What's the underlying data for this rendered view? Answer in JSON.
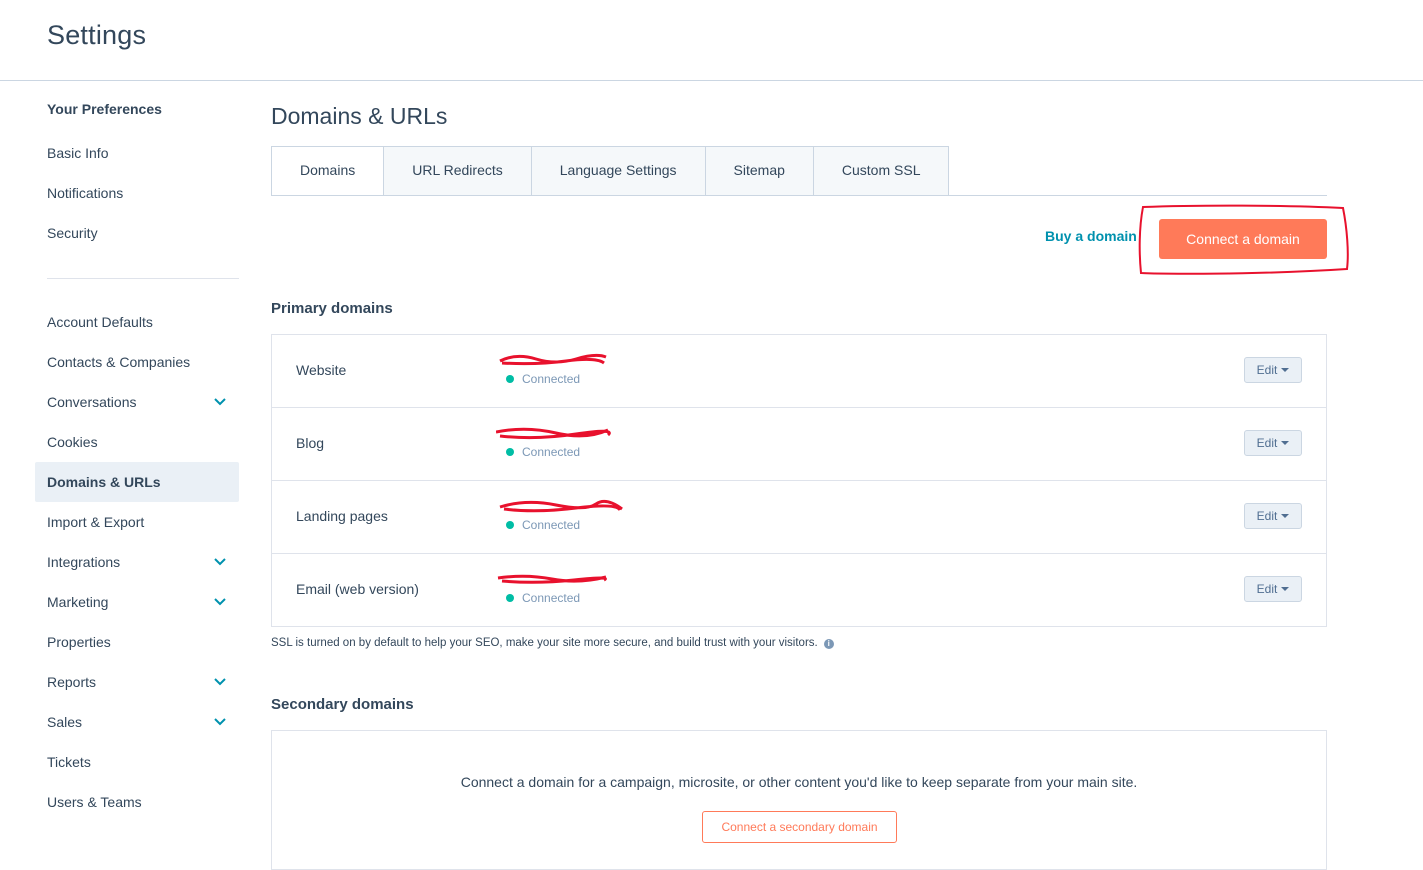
{
  "header": {
    "title": "Settings"
  },
  "sidebar": {
    "group_title": "Your Preferences",
    "pref_items": [
      {
        "label": "Basic Info"
      },
      {
        "label": "Notifications"
      },
      {
        "label": "Security"
      }
    ],
    "account_items": [
      {
        "label": "Account Defaults",
        "expandable": false
      },
      {
        "label": "Contacts & Companies",
        "expandable": false
      },
      {
        "label": "Conversations",
        "expandable": true
      },
      {
        "label": "Cookies",
        "expandable": false
      },
      {
        "label": "Domains & URLs",
        "expandable": false,
        "active": true
      },
      {
        "label": "Import & Export",
        "expandable": false
      },
      {
        "label": "Integrations",
        "expandable": true
      },
      {
        "label": "Marketing",
        "expandable": true
      },
      {
        "label": "Properties",
        "expandable": false
      },
      {
        "label": "Reports",
        "expandable": true
      },
      {
        "label": "Sales",
        "expandable": true
      },
      {
        "label": "Tickets",
        "expandable": false
      },
      {
        "label": "Users & Teams",
        "expandable": false
      }
    ]
  },
  "main": {
    "title": "Domains & URLs",
    "tabs": [
      {
        "label": "Domains",
        "active": true
      },
      {
        "label": "URL Redirects"
      },
      {
        "label": "Language Settings"
      },
      {
        "label": "Sitemap"
      },
      {
        "label": "Custom SSL"
      }
    ],
    "buy_domain_label": "Buy a domain",
    "connect_domain_label": "Connect a domain",
    "primary_title": "Primary domains",
    "primary_domains": [
      {
        "label": "Website",
        "status": "Connected",
        "edit_label": "Edit"
      },
      {
        "label": "Blog",
        "status": "Connected",
        "edit_label": "Edit"
      },
      {
        "label": "Landing pages",
        "status": "Connected",
        "edit_label": "Edit"
      },
      {
        "label": "Email (web version)",
        "status": "Connected",
        "edit_label": "Edit"
      }
    ],
    "ssl_note": "SSL is turned on by default to help your SEO, make your site more secure, and build trust with your visitors.",
    "secondary_title": "Secondary domains",
    "secondary_text": "Connect a domain for a campaign, microsite, or other content you'd like to keep separate from your main site.",
    "secondary_button_label": "Connect a secondary domain"
  },
  "colors": {
    "accent": "#ff7a59",
    "link": "#0091ae",
    "text": "#33475b",
    "status_connected": "#00bda5",
    "annotation": "#e8112d"
  }
}
